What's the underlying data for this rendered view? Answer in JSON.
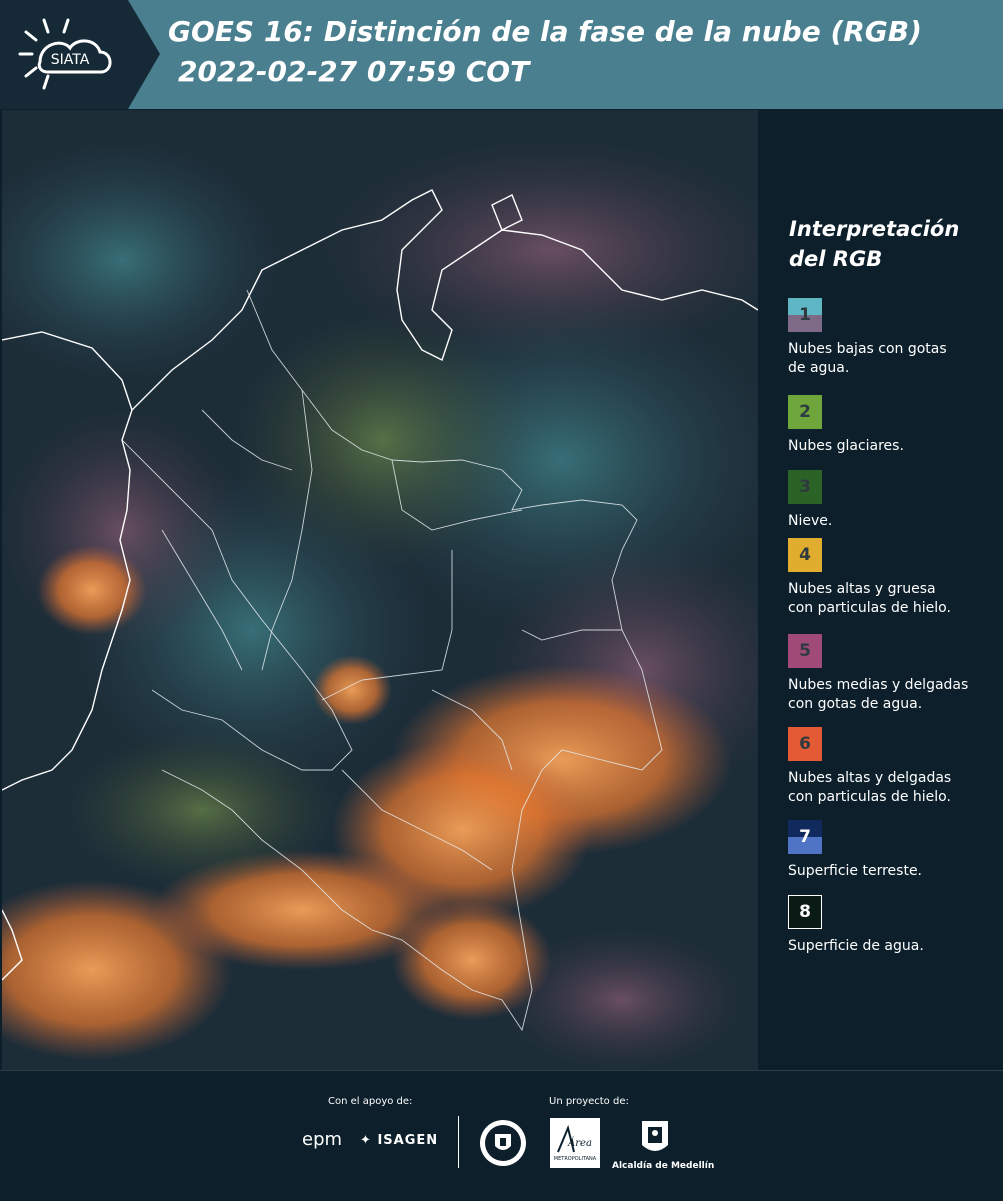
{
  "header": {
    "title": "GOES 16: Distinción de la fase de la nube (RGB)",
    "subtitle": "2022-02-27 07:59 COT",
    "logo_text": "SIATA"
  },
  "legend": {
    "title_line1": "Interpretación",
    "title_line2": "del RGB",
    "items": [
      {
        "num": "1",
        "text_line1": "Nubes bajas con gotas",
        "text_line2": "de agua.",
        "color_top": "#5fb6c5",
        "color_bottom": "#7e6a86"
      },
      {
        "num": "2",
        "text_line1": "Nubes glaciares.",
        "text_line2": "",
        "color_top": "#6fa63c",
        "color_bottom": "#6fa63c"
      },
      {
        "num": "3",
        "text_line1": "Nieve.",
        "text_line2": "",
        "color_top": "#2b6327",
        "color_bottom": "#2b6327"
      },
      {
        "num": "4",
        "text_line1": "Nubes altas y gruesa",
        "text_line2": "con particulas de hielo.",
        "color_top": "#e0ad2e",
        "color_bottom": "#e0ad2e"
      },
      {
        "num": "5",
        "text_line1": "Nubes medias y delgadas",
        "text_line2": "con gotas de agua.",
        "color_top": "#a04a78",
        "color_bottom": "#a04a78"
      },
      {
        "num": "6",
        "text_line1": "Nubes altas y delgadas",
        "text_line2": "con particulas de hielo.",
        "color_top": "#e35a35",
        "color_bottom": "#e35a35"
      },
      {
        "num": "7",
        "text_line1": "Superficie terreste.",
        "text_line2": "",
        "color_top": "#102a5e",
        "color_bottom": "#4f74c6"
      },
      {
        "num": "8",
        "text_line1": "Superficie de agua.",
        "text_line2": "",
        "color_top": "#0a1a14",
        "color_bottom": "#0a1a14"
      }
    ]
  },
  "footer": {
    "support_label": "Con el apoyo de:",
    "project_label": "Un proyecto de:",
    "epm": "epm",
    "isagen": "ISAGEN",
    "area_label": "Área",
    "area_sub": "METROPOLITANA",
    "alcaldia_label": "Alcaldía de Medellín"
  },
  "colors": {
    "header_bg": "#4a7f8f",
    "panel_bg": "#0c1f2b",
    "ice_orange": "#e8792f"
  },
  "icons": [
    "sun-cloud-logo-icon",
    "isagen-star-icon",
    "gobernacion-seal-icon",
    "area-metropolitana-icon",
    "alcaldia-shield-icon"
  ]
}
